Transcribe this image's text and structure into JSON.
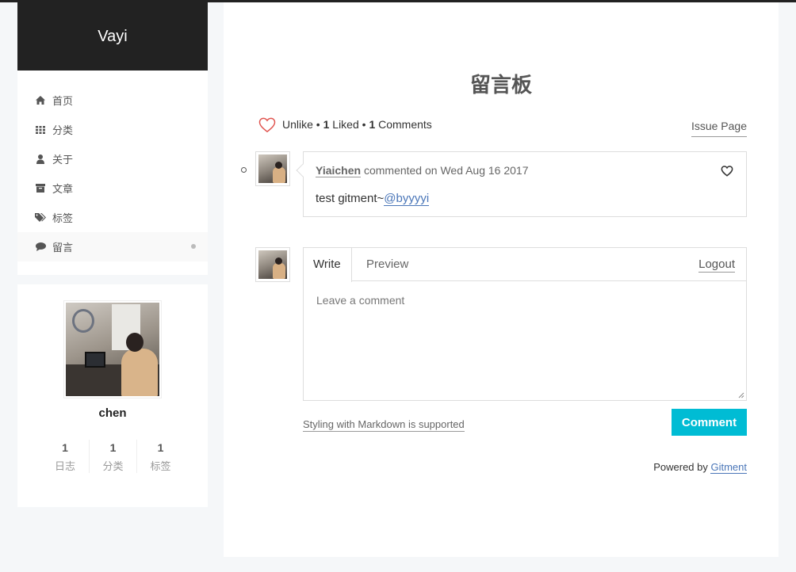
{
  "site": {
    "title": "Vayi"
  },
  "menu": [
    {
      "label": "首页",
      "icon": "home-icon"
    },
    {
      "label": "分类",
      "icon": "grid-icon"
    },
    {
      "label": "关于",
      "icon": "user-icon"
    },
    {
      "label": "文章",
      "icon": "archive-icon"
    },
    {
      "label": "标签",
      "icon": "tags-icon"
    },
    {
      "label": "留言",
      "icon": "comment-icon",
      "active": true
    }
  ],
  "profile": {
    "name": "chen",
    "stats": [
      {
        "value": "1",
        "label": "日志"
      },
      {
        "value": "1",
        "label": "分类"
      },
      {
        "value": "1",
        "label": "标签"
      }
    ]
  },
  "page": {
    "title": "留言板"
  },
  "gitment": {
    "like_action": "Unlike",
    "sep1": " • ",
    "liked_count": "1",
    "liked_label": " Liked",
    "sep2": " • ",
    "comment_count": "1",
    "comment_label": " Comments",
    "issue_link": "Issue Page",
    "comment": {
      "author": "Yiaichen",
      "meta": " commented on Wed Aug 16 2017",
      "body_prefix": "test gitment~",
      "mention": "@byyyyi"
    },
    "editor": {
      "tab_write": "Write",
      "tab_preview": "Preview",
      "logout": "Logout",
      "placeholder": "Leave a comment"
    },
    "markdown_note": "Styling with Markdown is supported",
    "submit": "Comment",
    "powered_prefix": "Powered by ",
    "powered_link": "Gitment"
  },
  "colors": {
    "accent": "#00bcd4",
    "heart": "#e0544f",
    "link": "#4a76b8",
    "header": "#222222"
  }
}
